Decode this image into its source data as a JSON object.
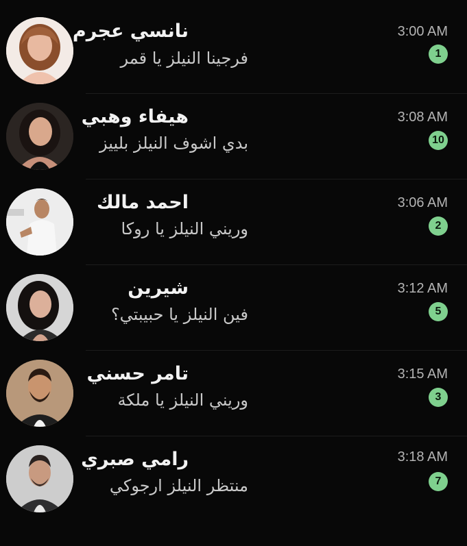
{
  "chats": [
    {
      "name": "نانسي عجرم",
      "preview": "فرجينا النيلز يا قمر",
      "time": "3:00 AM",
      "unread": "1",
      "avatar_icon": "contact-avatar"
    },
    {
      "name": "هيفاء وهبي",
      "preview": "بدي اشوف النيلز بلييز",
      "time": "3:08 AM",
      "unread": "10",
      "avatar_icon": "contact-avatar"
    },
    {
      "name": "احمد مالك",
      "preview": "وريني النيلز يا روكا",
      "time": "3:06 AM",
      "unread": "2",
      "avatar_icon": "contact-avatar"
    },
    {
      "name": "شيرين",
      "preview": "فين النيلز يا حبيبتي؟",
      "time": "3:12 AM",
      "unread": "5",
      "avatar_icon": "contact-avatar"
    },
    {
      "name": "تامر حسني",
      "preview": "وريني النيلز يا ملكة",
      "time": "3:15 AM",
      "unread": "3",
      "avatar_icon": "contact-avatar"
    },
    {
      "name": "رامي صبري",
      "preview": "منتظر النيلز ارجوكي",
      "time": "3:18 AM",
      "unread": "7",
      "avatar_icon": "contact-avatar"
    }
  ],
  "colors": {
    "background": "#080808",
    "name_text": "#f2f2f2",
    "preview_text": "#c9c9c9",
    "time_text": "#b4b4b4",
    "unread_badge": "#7fd08e",
    "divider": "#1c1c1c"
  }
}
